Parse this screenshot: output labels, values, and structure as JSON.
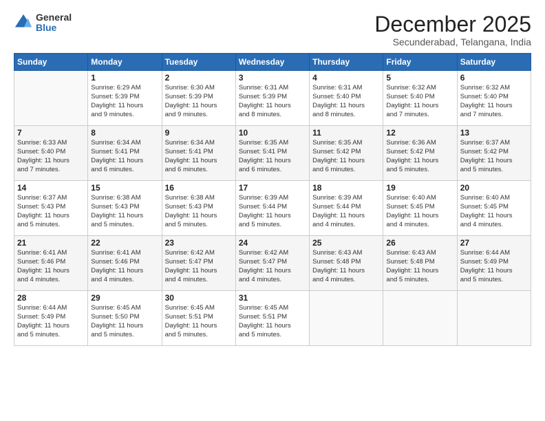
{
  "logo": {
    "general": "General",
    "blue": "Blue"
  },
  "header": {
    "month": "December 2025",
    "location": "Secunderabad, Telangana, India"
  },
  "days": [
    "Sunday",
    "Monday",
    "Tuesday",
    "Wednesday",
    "Thursday",
    "Friday",
    "Saturday"
  ],
  "weeks": [
    [
      {
        "day": "",
        "content": ""
      },
      {
        "day": "1",
        "content": "Sunrise: 6:29 AM\nSunset: 5:39 PM\nDaylight: 11 hours\nand 9 minutes."
      },
      {
        "day": "2",
        "content": "Sunrise: 6:30 AM\nSunset: 5:39 PM\nDaylight: 11 hours\nand 9 minutes."
      },
      {
        "day": "3",
        "content": "Sunrise: 6:31 AM\nSunset: 5:39 PM\nDaylight: 11 hours\nand 8 minutes."
      },
      {
        "day": "4",
        "content": "Sunrise: 6:31 AM\nSunset: 5:40 PM\nDaylight: 11 hours\nand 8 minutes."
      },
      {
        "day": "5",
        "content": "Sunrise: 6:32 AM\nSunset: 5:40 PM\nDaylight: 11 hours\nand 7 minutes."
      },
      {
        "day": "6",
        "content": "Sunrise: 6:32 AM\nSunset: 5:40 PM\nDaylight: 11 hours\nand 7 minutes."
      }
    ],
    [
      {
        "day": "7",
        "content": "Sunrise: 6:33 AM\nSunset: 5:40 PM\nDaylight: 11 hours\nand 7 minutes."
      },
      {
        "day": "8",
        "content": "Sunrise: 6:34 AM\nSunset: 5:41 PM\nDaylight: 11 hours\nand 6 minutes."
      },
      {
        "day": "9",
        "content": "Sunrise: 6:34 AM\nSunset: 5:41 PM\nDaylight: 11 hours\nand 6 minutes."
      },
      {
        "day": "10",
        "content": "Sunrise: 6:35 AM\nSunset: 5:41 PM\nDaylight: 11 hours\nand 6 minutes."
      },
      {
        "day": "11",
        "content": "Sunrise: 6:35 AM\nSunset: 5:42 PM\nDaylight: 11 hours\nand 6 minutes."
      },
      {
        "day": "12",
        "content": "Sunrise: 6:36 AM\nSunset: 5:42 PM\nDaylight: 11 hours\nand 5 minutes."
      },
      {
        "day": "13",
        "content": "Sunrise: 6:37 AM\nSunset: 5:42 PM\nDaylight: 11 hours\nand 5 minutes."
      }
    ],
    [
      {
        "day": "14",
        "content": "Sunrise: 6:37 AM\nSunset: 5:43 PM\nDaylight: 11 hours\nand 5 minutes."
      },
      {
        "day": "15",
        "content": "Sunrise: 6:38 AM\nSunset: 5:43 PM\nDaylight: 11 hours\nand 5 minutes."
      },
      {
        "day": "16",
        "content": "Sunrise: 6:38 AM\nSunset: 5:43 PM\nDaylight: 11 hours\nand 5 minutes."
      },
      {
        "day": "17",
        "content": "Sunrise: 6:39 AM\nSunset: 5:44 PM\nDaylight: 11 hours\nand 5 minutes."
      },
      {
        "day": "18",
        "content": "Sunrise: 6:39 AM\nSunset: 5:44 PM\nDaylight: 11 hours\nand 4 minutes."
      },
      {
        "day": "19",
        "content": "Sunrise: 6:40 AM\nSunset: 5:45 PM\nDaylight: 11 hours\nand 4 minutes."
      },
      {
        "day": "20",
        "content": "Sunrise: 6:40 AM\nSunset: 5:45 PM\nDaylight: 11 hours\nand 4 minutes."
      }
    ],
    [
      {
        "day": "21",
        "content": "Sunrise: 6:41 AM\nSunset: 5:46 PM\nDaylight: 11 hours\nand 4 minutes."
      },
      {
        "day": "22",
        "content": "Sunrise: 6:41 AM\nSunset: 5:46 PM\nDaylight: 11 hours\nand 4 minutes."
      },
      {
        "day": "23",
        "content": "Sunrise: 6:42 AM\nSunset: 5:47 PM\nDaylight: 11 hours\nand 4 minutes."
      },
      {
        "day": "24",
        "content": "Sunrise: 6:42 AM\nSunset: 5:47 PM\nDaylight: 11 hours\nand 4 minutes."
      },
      {
        "day": "25",
        "content": "Sunrise: 6:43 AM\nSunset: 5:48 PM\nDaylight: 11 hours\nand 4 minutes."
      },
      {
        "day": "26",
        "content": "Sunrise: 6:43 AM\nSunset: 5:48 PM\nDaylight: 11 hours\nand 5 minutes."
      },
      {
        "day": "27",
        "content": "Sunrise: 6:44 AM\nSunset: 5:49 PM\nDaylight: 11 hours\nand 5 minutes."
      }
    ],
    [
      {
        "day": "28",
        "content": "Sunrise: 6:44 AM\nSunset: 5:49 PM\nDaylight: 11 hours\nand 5 minutes."
      },
      {
        "day": "29",
        "content": "Sunrise: 6:45 AM\nSunset: 5:50 PM\nDaylight: 11 hours\nand 5 minutes."
      },
      {
        "day": "30",
        "content": "Sunrise: 6:45 AM\nSunset: 5:51 PM\nDaylight: 11 hours\nand 5 minutes."
      },
      {
        "day": "31",
        "content": "Sunrise: 6:45 AM\nSunset: 5:51 PM\nDaylight: 11 hours\nand 5 minutes."
      },
      {
        "day": "",
        "content": ""
      },
      {
        "day": "",
        "content": ""
      },
      {
        "day": "",
        "content": ""
      }
    ]
  ]
}
